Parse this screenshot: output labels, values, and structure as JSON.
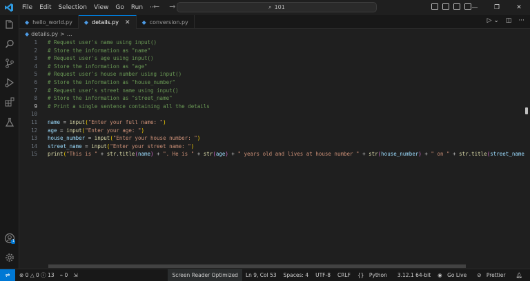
{
  "menu": [
    "File",
    "Edit",
    "Selection",
    "View",
    "Go",
    "Run",
    "···"
  ],
  "search": {
    "text": "101"
  },
  "tabs": [
    {
      "label": "hello_world.py",
      "active": false
    },
    {
      "label": "details.py",
      "active": true
    },
    {
      "label": "conversion.py",
      "active": false
    }
  ],
  "breadcrumb": {
    "file": "details.py",
    "sep": ">",
    "more": "..."
  },
  "code_lines": [
    {
      "n": "1",
      "tokens": [
        {
          "t": "# Request user's name using input()",
          "k": "c"
        }
      ]
    },
    {
      "n": "2",
      "tokens": [
        {
          "t": "# Store the information as \"name\"",
          "k": "c"
        }
      ]
    },
    {
      "n": "3",
      "tokens": [
        {
          "t": "# Request user's age using input()",
          "k": "c"
        }
      ]
    },
    {
      "n": "4",
      "tokens": [
        {
          "t": "# Store the information as \"age\"",
          "k": "c"
        }
      ]
    },
    {
      "n": "5",
      "tokens": [
        {
          "t": "# Request user's house number using input()",
          "k": "c"
        }
      ]
    },
    {
      "n": "6",
      "tokens": [
        {
          "t": "# Store the information as \"house_number\"",
          "k": "c"
        }
      ]
    },
    {
      "n": "7",
      "tokens": [
        {
          "t": "# Request user's street name using input()",
          "k": "c"
        }
      ]
    },
    {
      "n": "8",
      "tokens": [
        {
          "t": "# Store the information as \"street_name\"",
          "k": "c"
        }
      ]
    },
    {
      "n": "9",
      "tokens": [
        {
          "t": "# Print a single sentence containing all the details",
          "k": "c"
        }
      ]
    },
    {
      "n": "10",
      "tokens": []
    },
    {
      "n": "11",
      "tokens": [
        {
          "t": "name",
          "k": "v"
        },
        {
          "t": " = ",
          "k": "o"
        },
        {
          "t": "input",
          "k": "f"
        },
        {
          "t": "(",
          "k": "p"
        },
        {
          "t": "\"Enter your full name: \"",
          "k": "s"
        },
        {
          "t": ")",
          "k": "p"
        }
      ]
    },
    {
      "n": "12",
      "tokens": [
        {
          "t": "age",
          "k": "v"
        },
        {
          "t": " = ",
          "k": "o"
        },
        {
          "t": "input",
          "k": "f"
        },
        {
          "t": "(",
          "k": "p"
        },
        {
          "t": "\"Enter your age: \"",
          "k": "s"
        },
        {
          "t": ")",
          "k": "p"
        }
      ]
    },
    {
      "n": "13",
      "tokens": [
        {
          "t": "house_number",
          "k": "v"
        },
        {
          "t": " = ",
          "k": "o"
        },
        {
          "t": "input",
          "k": "f"
        },
        {
          "t": "(",
          "k": "p"
        },
        {
          "t": "\"Enter your house number: \"",
          "k": "s"
        },
        {
          "t": ")",
          "k": "p"
        }
      ]
    },
    {
      "n": "14",
      "tokens": [
        {
          "t": "street_name",
          "k": "v"
        },
        {
          "t": " = ",
          "k": "o"
        },
        {
          "t": "input",
          "k": "f"
        },
        {
          "t": "(",
          "k": "p"
        },
        {
          "t": "\"Enter your street name: \"",
          "k": "s"
        },
        {
          "t": ")",
          "k": "p"
        }
      ]
    },
    {
      "n": "15",
      "tokens": [
        {
          "t": "print",
          "k": "f"
        },
        {
          "t": "(",
          "k": "p"
        },
        {
          "t": "\"This is \"",
          "k": "s"
        },
        {
          "t": " + ",
          "k": "o"
        },
        {
          "t": "str",
          "k": "f"
        },
        {
          "t": ".",
          "k": "o"
        },
        {
          "t": "title",
          "k": "f"
        },
        {
          "t": "(",
          "k": "p2"
        },
        {
          "t": "name",
          "k": "v"
        },
        {
          "t": ")",
          "k": "p2"
        },
        {
          "t": " + ",
          "k": "o"
        },
        {
          "t": "\". He is \"",
          "k": "s"
        },
        {
          "t": " + ",
          "k": "o"
        },
        {
          "t": "str",
          "k": "f"
        },
        {
          "t": "(",
          "k": "p2"
        },
        {
          "t": "age",
          "k": "v"
        },
        {
          "t": ")",
          "k": "p2"
        },
        {
          "t": " + ",
          "k": "o"
        },
        {
          "t": "\" years old and lives at house number \"",
          "k": "s"
        },
        {
          "t": " + ",
          "k": "o"
        },
        {
          "t": "str",
          "k": "f"
        },
        {
          "t": "(",
          "k": "p2"
        },
        {
          "t": "house_number",
          "k": "v"
        },
        {
          "t": ")",
          "k": "p2"
        },
        {
          "t": " + ",
          "k": "o"
        },
        {
          "t": "\" on \"",
          "k": "s"
        },
        {
          "t": " + ",
          "k": "o"
        },
        {
          "t": "str",
          "k": "f"
        },
        {
          "t": ".",
          "k": "o"
        },
        {
          "t": "title",
          "k": "f"
        },
        {
          "t": "(",
          "k": "p2"
        },
        {
          "t": "street_name",
          "k": "v"
        }
      ]
    }
  ],
  "current_line": "9",
  "status": {
    "errors": "0",
    "warnings": "0",
    "info": "13",
    "ports": "0",
    "screen_reader": "Screen Reader Optimized",
    "position": "Ln 9, Col 53",
    "spaces": "Spaces: 4",
    "encoding": "UTF-8",
    "eol": "CRLF",
    "language": "Python",
    "interpreter": "3.12.1 64-bit",
    "golive": "Go Live",
    "prettier": "Prettier"
  },
  "accounts_badge": "1",
  "colors": {
    "accent": "#0078d4",
    "editor_bg": "#1f1f1f",
    "comment": "#6a9955",
    "string": "#ce9178",
    "function": "#dcdcaa",
    "variable": "#9cdcfe"
  },
  "icons": [
    "vscode-logo-icon",
    "explorer-icon",
    "search-icon",
    "source-control-icon",
    "run-debug-icon",
    "extensions-icon",
    "testing-icon",
    "accounts-icon",
    "gear-icon"
  ]
}
